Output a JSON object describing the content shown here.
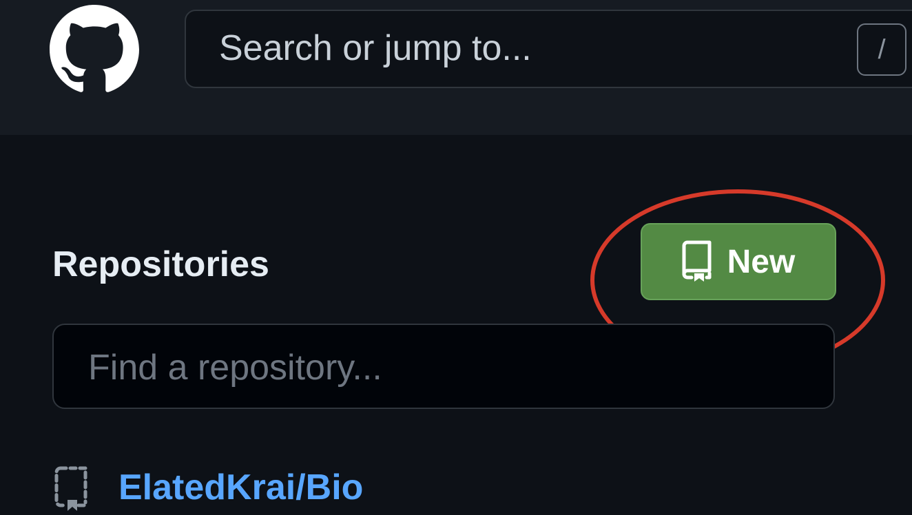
{
  "header": {
    "logo_icon": "github-octocat-icon",
    "search": {
      "placeholder": "Search or jump to...",
      "shortcut_key": "/"
    }
  },
  "repositories": {
    "title": "Repositories",
    "new_button": {
      "label": "New",
      "icon": "repo-icon",
      "color": "#538a44"
    },
    "find_input": {
      "placeholder": "Find a repository..."
    },
    "items": [
      {
        "name": "ElatedKrai/Bio",
        "icon": "repo-template-icon"
      }
    ]
  },
  "annotation": {
    "type": "circle-highlight",
    "color": "#d63a2a"
  },
  "colors": {
    "background": "#0d1117",
    "header_background": "#161b22",
    "link": "#58a6ff"
  }
}
